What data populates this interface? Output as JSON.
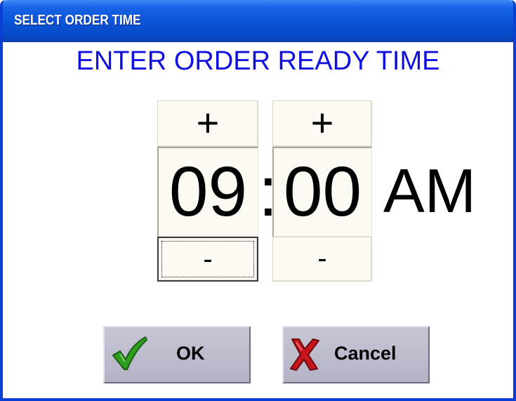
{
  "window": {
    "title": "SELECT ORDER TIME"
  },
  "heading": "ENTER ORDER READY TIME",
  "time": {
    "hour": "09",
    "separator": ":",
    "minute": "00",
    "period": "AM",
    "increment_label": "+",
    "decrement_label": "-"
  },
  "actions": {
    "ok_label": "OK",
    "cancel_label": "Cancel"
  },
  "icons": {
    "ok": "checkmark-icon",
    "cancel": "x-icon"
  },
  "colors": {
    "titlebar": "#0a55d8",
    "heading": "#1010e0",
    "check": "#2f9e1f",
    "cross": "#c8141c",
    "button_face": "#bdbdcd"
  }
}
